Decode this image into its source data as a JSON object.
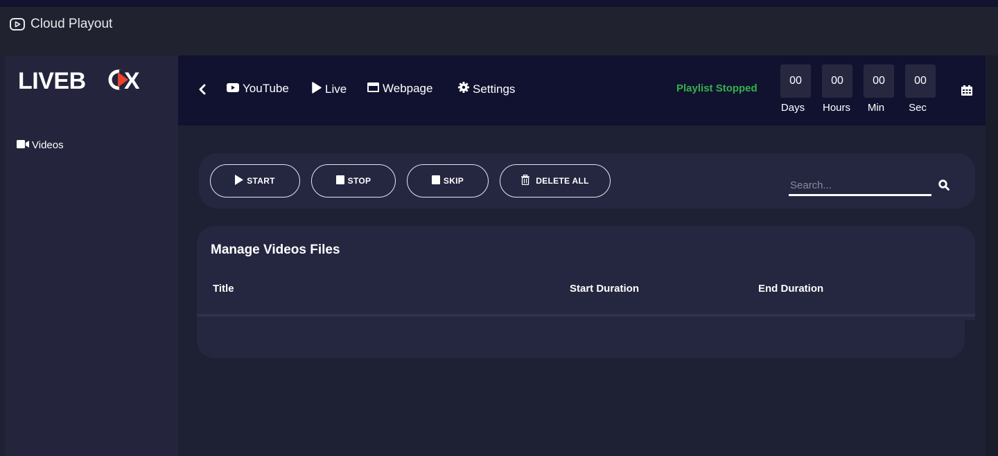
{
  "app": {
    "title": "Cloud Playout",
    "icon": "play-circle-icon"
  },
  "sidebar": {
    "logo": {
      "text_prefix": "LIVEB",
      "text_suffix": "X",
      "accent_color": "#e8442a"
    },
    "items": [
      {
        "label": "Videos",
        "icon": "video-camera-icon"
      }
    ]
  },
  "topnav": {
    "back_icon": "chevron-left-icon",
    "items": [
      {
        "label": "YouTube",
        "icon": "youtube-icon"
      },
      {
        "label": "Live",
        "icon": "play-icon"
      },
      {
        "label": "Webpage",
        "icon": "window-icon"
      },
      {
        "label": "Settings",
        "icon": "gear-icon"
      }
    ],
    "status": {
      "text": "Playlist Stopped",
      "color": "#33b24a"
    },
    "countdown": [
      {
        "value": "00",
        "label": "Days"
      },
      {
        "value": "00",
        "label": "Hours"
      },
      {
        "value": "00",
        "label": "Min"
      },
      {
        "value": "00",
        "label": "Sec"
      }
    ],
    "calendar_icon": "calendar-icon"
  },
  "controls": {
    "buttons": [
      {
        "label": "START",
        "icon": "play-icon"
      },
      {
        "label": "STOP",
        "icon": "stop-icon"
      },
      {
        "label": "SKIP",
        "icon": "stop-icon"
      },
      {
        "label": "DELETE ALL",
        "icon": "trash-icon"
      }
    ],
    "search": {
      "placeholder": "Search...",
      "value": ""
    }
  },
  "videos_card": {
    "title": "Manage Videos Files",
    "columns": [
      "Title",
      "Start Duration",
      "End Duration"
    ],
    "rows": []
  }
}
